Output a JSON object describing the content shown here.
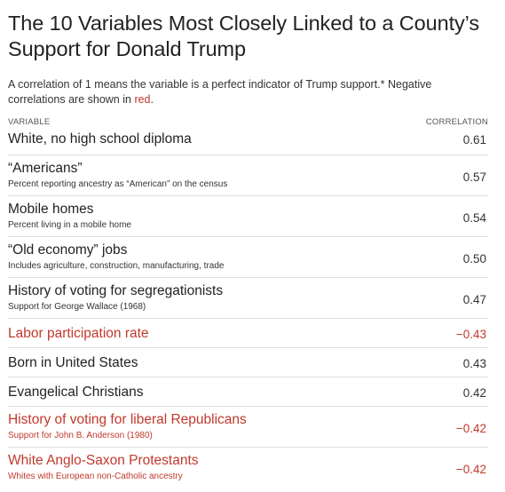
{
  "title": "The 10 Variables Most Closely Linked to a County’s Support for Donald Trump",
  "intro": {
    "text": "A correlation of 1 means the variable is a perfect indicator of Trump support.* Negative correlations are shown in ",
    "neg_word": "red",
    "end": "."
  },
  "colors": {
    "text": "#222222",
    "negative": "#c0392b",
    "rule": "#dddddd"
  },
  "chart_data": {
    "type": "table",
    "column_headers": {
      "variable": "VARIABLE",
      "correlation": "CORRELATION"
    },
    "rows": [
      {
        "variable": "White, no high school diploma",
        "note": "",
        "correlation": 0.61,
        "display": "0.61",
        "negative": false
      },
      {
        "variable": "“Americans”",
        "note": "Percent reporting ancestry as “American” on the census",
        "correlation": 0.57,
        "display": "0.57",
        "negative": false
      },
      {
        "variable": "Mobile homes",
        "note": "Percent living in a mobile home",
        "correlation": 0.54,
        "display": "0.54",
        "negative": false
      },
      {
        "variable": "“Old economy” jobs",
        "note": "Includes agriculture, construction, manufacturing, trade",
        "correlation": 0.5,
        "display": "0.50",
        "negative": false
      },
      {
        "variable": "History of voting for segregationists",
        "note": "Support for George Wallace (1968)",
        "correlation": 0.47,
        "display": "0.47",
        "negative": false
      },
      {
        "variable": "Labor participation rate",
        "note": "",
        "correlation": -0.43,
        "display": "−0.43",
        "negative": true
      },
      {
        "variable": "Born in United States",
        "note": "",
        "correlation": 0.43,
        "display": "0.43",
        "negative": false
      },
      {
        "variable": "Evangelical Christians",
        "note": "",
        "correlation": 0.42,
        "display": "0.42",
        "negative": false
      },
      {
        "variable": "History of voting for liberal Republicans",
        "note": "Support for John B. Anderson (1980)",
        "correlation": -0.42,
        "display": "−0.42",
        "negative": true
      },
      {
        "variable": "White Anglo-Saxon Protestants",
        "note": "Whites with European non-Catholic ancestry",
        "correlation": -0.42,
        "display": "−0.42",
        "negative": true
      }
    ]
  }
}
